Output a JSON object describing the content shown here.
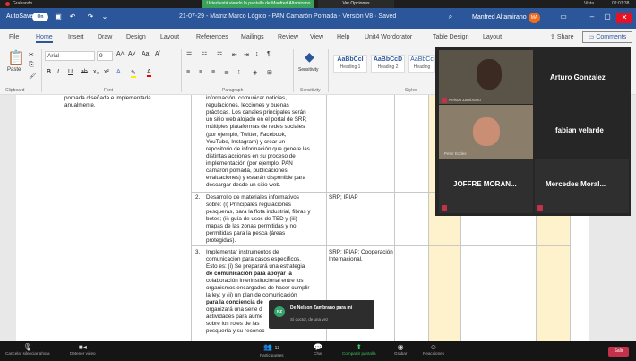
{
  "system": {
    "recording_label": "Grabando",
    "share_banner": "Usted está viendo la pantalla de Manfred Altamirano",
    "view_options": "Ver Opciones",
    "view_label": "Vista",
    "time": "02:07:38"
  },
  "titlebar": {
    "autosave_label": "AutoSave",
    "autosave_state": "On",
    "doc_title": "21-07-29 - Matriz Marco Lógico - PAN Camarón Pomada - Versión V8 · Saved",
    "user_name": "Manfred Altamirano",
    "user_initials": "MA"
  },
  "tabs": [
    "File",
    "Home",
    "Insert",
    "Draw",
    "Design",
    "Layout",
    "References",
    "Mailings",
    "Review",
    "View",
    "Help",
    "Unit4 Wordorator",
    "Table Design",
    "Layout"
  ],
  "share_label": "Share",
  "comments_label": "Comments",
  "ribbon": {
    "paste_label": "Paste",
    "font_name": "Arial",
    "font_size": "9",
    "sensitivity_label": "Sensitivity",
    "style_1_sample": "AaBbCcI",
    "style_1_name": "Heading 1",
    "style_2_sample": "AaBbCcD",
    "style_2_name": "Heading 2",
    "style_3_sample": "AaBbCc",
    "style_3_name": "Heading",
    "groups": {
      "clipboard": "Clipboard",
      "font": "Font",
      "paragraph": "Paragraph",
      "sensitivity": "Sensitivity",
      "styles": "Styles"
    }
  },
  "document": {
    "left_col_lines": [
      "pomada diseñada e implementada",
      "anualmente."
    ],
    "item1_lines": [
      "información, comunicar noticias,",
      "regulaciones, lecciones y buenas",
      "prácticas. Los canales principales serán",
      "un sitio web alojado en el portal de SRP,",
      "múltiples plataformas de redes sociales",
      "(por ejemplo, Twitter, Facebook,",
      "YouTube, Instagram) y crear un",
      "repositorio de información que genere las",
      "distintas acciones en su proceso de",
      "implementación (por ejemplo, PAN",
      "camarón pomada, publicaciones,",
      "evaluaciones) y estarán disponible para",
      "descargar desde un sitio web."
    ],
    "item2_number": "2.",
    "item2_lines": [
      "Desarrollo de materiales informativos",
      "sobre: (i) Principales regulaciones",
      "pesqueras, para la flota industrial, fibras y",
      "botes; (ii) guía de usos de TED y (iii)",
      "mapas de las zonas permitidas y no",
      "permitidas para la pesca (áreas",
      "protegidas)."
    ],
    "item2_resp": "SRP; IPIAP",
    "item3_number": "3.",
    "item3_lines": [
      "Implementar instrumentos de",
      "comunicación para casos específicos.",
      "Esto es: (i) Se preparará una estrategia",
      "de comunicación para apoyar la",
      "colaboración interinstitucional entre los",
      "organismos encargados de hacer cumplir",
      "la ley; y (ii) un plan de comunicación",
      "para la conciencia de",
      "organizará una serie d",
      "actividades para aume",
      "sobre los roles de las",
      "pesquería y su reconoc"
    ],
    "item3_resp_lines": [
      "SRP; IPIAP; Cooperación",
      "Internacional."
    ]
  },
  "teams": {
    "tile1_name": "Arturo Gonzalez",
    "tile1_small": "Nelson Zambrano",
    "tile2_name": "fabian velarde",
    "tile2_small": "Peter Ecdes",
    "tile3_name": "JOFFRE MORAN...",
    "tile4_name": "Mercedes Moral..."
  },
  "notification": {
    "initials": "NZ",
    "title": "De Nelson Zambrano para mí",
    "message": "Sí doctor, de una vez"
  },
  "controls": {
    "mute": "Cancelar silenciar ahora",
    "video": "Detener video",
    "participants": "Participantes",
    "participants_count": "13",
    "chat": "Chat",
    "share": "Compartir pantalla",
    "record": "Grabar",
    "reactions": "Reacciones",
    "leave": "Salir"
  }
}
